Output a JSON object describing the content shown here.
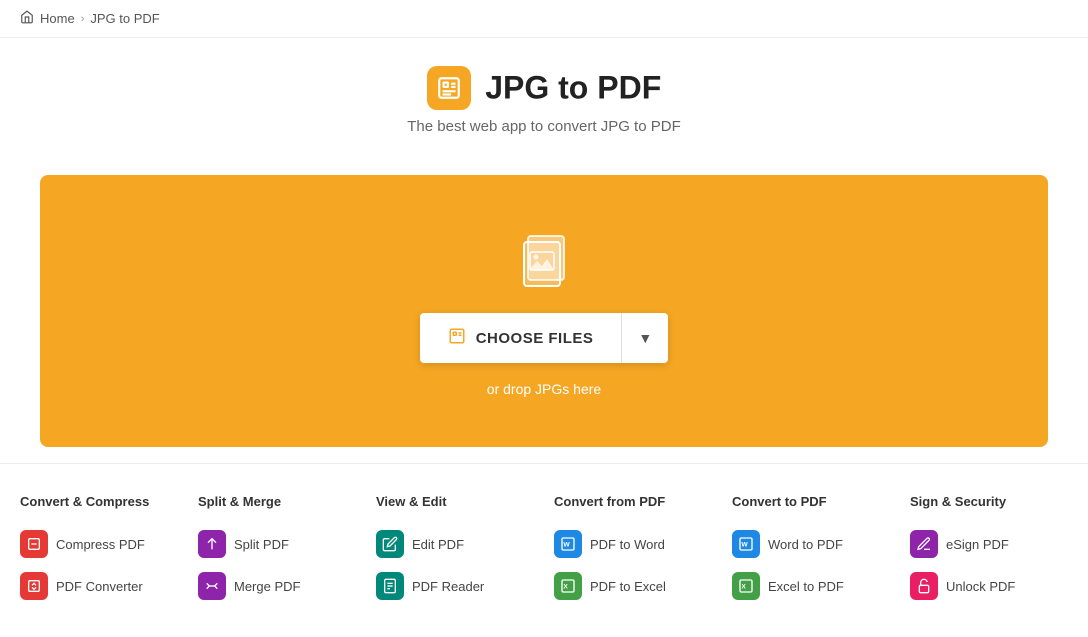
{
  "breadcrumb": {
    "home": "Home",
    "current": "JPG to PDF",
    "separator": "›"
  },
  "header": {
    "title": "JPG to PDF",
    "subtitle": "The best web app to convert JPG to PDF",
    "icon_label": "jpg-to-pdf-icon"
  },
  "dropzone": {
    "button_label": "CHOOSE FILES",
    "hint": "or drop JPGs here"
  },
  "tools": [
    {
      "category": "Convert & Compress",
      "items": [
        {
          "label": "Compress PDF",
          "icon_color": "icon-red",
          "icon": "📄"
        },
        {
          "label": "PDF Converter",
          "icon_color": "icon-red",
          "icon": "📄"
        }
      ]
    },
    {
      "category": "Split & Merge",
      "items": [
        {
          "label": "Split PDF",
          "icon_color": "icon-purple",
          "icon": "✂"
        },
        {
          "label": "Merge PDF",
          "icon_color": "icon-purple",
          "icon": "🔀"
        }
      ]
    },
    {
      "category": "View & Edit",
      "items": [
        {
          "label": "Edit PDF",
          "icon_color": "icon-teal",
          "icon": "✏"
        },
        {
          "label": "PDF Reader",
          "icon_color": "icon-teal",
          "icon": "📖"
        }
      ]
    },
    {
      "category": "Convert from PDF",
      "items": [
        {
          "label": "PDF to Word",
          "icon_color": "icon-blue",
          "icon": "W"
        },
        {
          "label": "PDF to Excel",
          "icon_color": "icon-green",
          "icon": "X"
        }
      ]
    },
    {
      "category": "Convert to PDF",
      "items": [
        {
          "label": "Word to PDF",
          "icon_color": "icon-blue",
          "icon": "W"
        },
        {
          "label": "Excel to PDF",
          "icon_color": "icon-green",
          "icon": "X"
        }
      ]
    },
    {
      "category": "Sign & Security",
      "items": [
        {
          "label": "eSign PDF",
          "icon_color": "icon-purple",
          "icon": "✍"
        },
        {
          "label": "Unlock PDF",
          "icon_color": "icon-pink",
          "icon": "🔓"
        }
      ]
    }
  ]
}
